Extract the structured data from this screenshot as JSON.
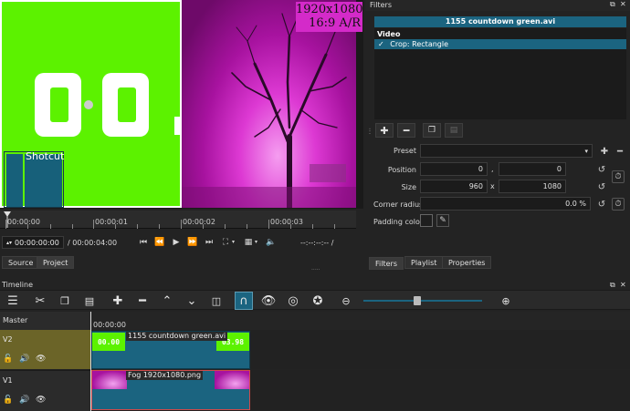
{
  "player": {
    "resolution_label": "1920x1080",
    "aspect_label": "16:9 A/R",
    "overlay_logo_text": "Shotcut",
    "countdown_digits": "00",
    "ruler_marks": [
      "00:00:00",
      "00:00:01",
      "00:00:02",
      "00:00:03"
    ],
    "current_time": "00:00:00:00",
    "total_time": "/ 00:00:04:00",
    "in_out_readout": "--:--:--:-- /",
    "tabs": [
      {
        "label": "Source"
      },
      {
        "label": "Project"
      }
    ]
  },
  "filters": {
    "panel_title": "Filters",
    "clip_name": "1155 countdown green.avi",
    "group_label": "Video",
    "active_filter": "Crop: Rectangle",
    "active_filter_check": "✓",
    "preset_label": "Preset",
    "preset_value": "",
    "position_label": "Position",
    "position_x": "0",
    "position_y": "0",
    "position_sep": ",",
    "size_label": "Size",
    "size_w": "960",
    "size_h": "1080",
    "size_sep": "x",
    "corner_label": "Corner radius",
    "corner_value": "0.0 %",
    "padding_label": "Padding color",
    "tabs": [
      {
        "label": "Filters"
      },
      {
        "label": "Playlist"
      },
      {
        "label": "Properties"
      }
    ]
  },
  "timeline": {
    "panel_title": "Timeline",
    "ruler_start": "00:00:00",
    "tracks": [
      {
        "name": "Master"
      },
      {
        "name": "V2"
      },
      {
        "name": "V1"
      }
    ],
    "clips": {
      "v2": {
        "label": "1155 countdown green.avi",
        "thumb_start": "00.00",
        "thumb_end": "03.98"
      },
      "v1": {
        "label": "Fog 1920x1080.png"
      }
    },
    "zoom_level": 0.45
  },
  "colors": {
    "accent": "#1b6480",
    "chroma_green": "#5cf200",
    "magenta": "#d42ac9",
    "v2_track": "#6b6428"
  }
}
